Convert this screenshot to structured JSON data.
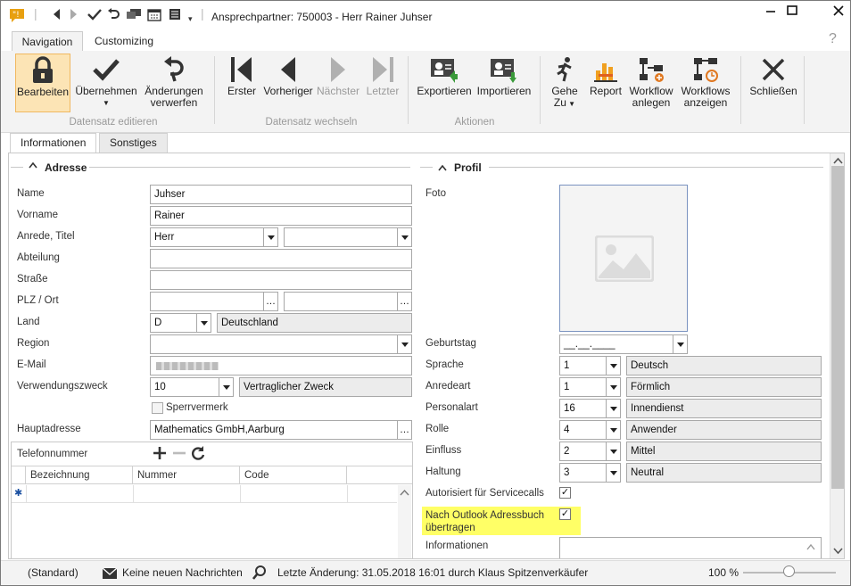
{
  "window": {
    "title": "Ansprechpartner: 750003 - Herr Rainer Juhser"
  },
  "ribbon_tabs": [
    "Navigation",
    "Customizing"
  ],
  "ribbon": {
    "bearbeiten": "Bearbeiten",
    "uebernehmen": "Übernehmen",
    "aenderungen_line1": "Änderungen",
    "aenderungen_line2": "verwerfen",
    "group1": "Datensatz editieren",
    "erster": "Erster",
    "vorheriger": "Vorheriger",
    "naechster": "Nächster",
    "letzter": "Letzter",
    "group2": "Datensatz wechseln",
    "exportieren": "Exportieren",
    "importieren": "Importieren",
    "group3": "Aktionen",
    "gehe_line1": "Gehe",
    "gehe_line2": "Zu",
    "report": "Report",
    "workflow_line1": "Workflow",
    "workflow_line2": "anlegen",
    "workflows_line1": "Workflows",
    "workflows_line2": "anzeigen",
    "schliessen": "Schließen"
  },
  "page_tabs": [
    "Informationen",
    "Sonstiges"
  ],
  "adresse": {
    "title": "Adresse",
    "labels": {
      "name": "Name",
      "vorname": "Vorname",
      "anrede": "Anrede, Titel",
      "abteilung": "Abteilung",
      "strasse": "Straße",
      "plz": "PLZ / Ort",
      "land": "Land",
      "region": "Region",
      "email": "E-Mail",
      "verwendung": "Verwendungszweck",
      "hauptadresse": "Hauptadresse"
    },
    "values": {
      "name": "Juhser",
      "vorname": "Rainer",
      "anrede": "Herr",
      "titel": "",
      "abteilung": "",
      "strasse": "",
      "plz": "",
      "ort": "",
      "land_code": "D",
      "land_name": "Deutschland",
      "region": "",
      "email": "",
      "verwendung_code": "10",
      "verwendung_name": "Vertraglicher Zweck",
      "hauptadresse": "Mathematics GmbH,Aarburg"
    },
    "sperrvermerk": "Sperrvermerk"
  },
  "telefon": {
    "title": "Telefonnummer",
    "columns": [
      "Bezeichnung",
      "Nummer",
      "Code"
    ],
    "new_row_marker": "✱"
  },
  "profil": {
    "title": "Profil",
    "labels": {
      "foto": "Foto",
      "geburtstag": "Geburtstag",
      "sprache": "Sprache",
      "anredeart": "Anredeart",
      "personalart": "Personalart",
      "rolle": "Rolle",
      "einfluss": "Einfluss",
      "haltung": "Haltung",
      "autorisiert": "Autorisiert für Servicecalls",
      "outlook_line1": "Nach Outlook Adressbuch",
      "outlook_line2": "übertragen",
      "informationen": "Informationen"
    },
    "values": {
      "geburtstag": "__.__.____",
      "sprache_code": "1",
      "sprache_name": "Deutsch",
      "anredeart_code": "1",
      "anredeart_name": "Förmlich",
      "personalart_code": "16",
      "personalart_name": "Innendienst",
      "rolle_code": "4",
      "rolle_name": "Anwender",
      "einfluss_code": "2",
      "einfluss_name": "Mittel",
      "haltung_code": "3",
      "haltung_name": "Neutral",
      "autorisiert": true,
      "outlook": true
    },
    "highlight_color": "#ffff66"
  },
  "status": {
    "layout": "(Standard)",
    "messages": "Keine neuen Nachrichten",
    "last_change": "Letzte Änderung: 31.05.2018 16:01 durch Klaus Spitzenverkäufer",
    "zoom": "100 %"
  }
}
